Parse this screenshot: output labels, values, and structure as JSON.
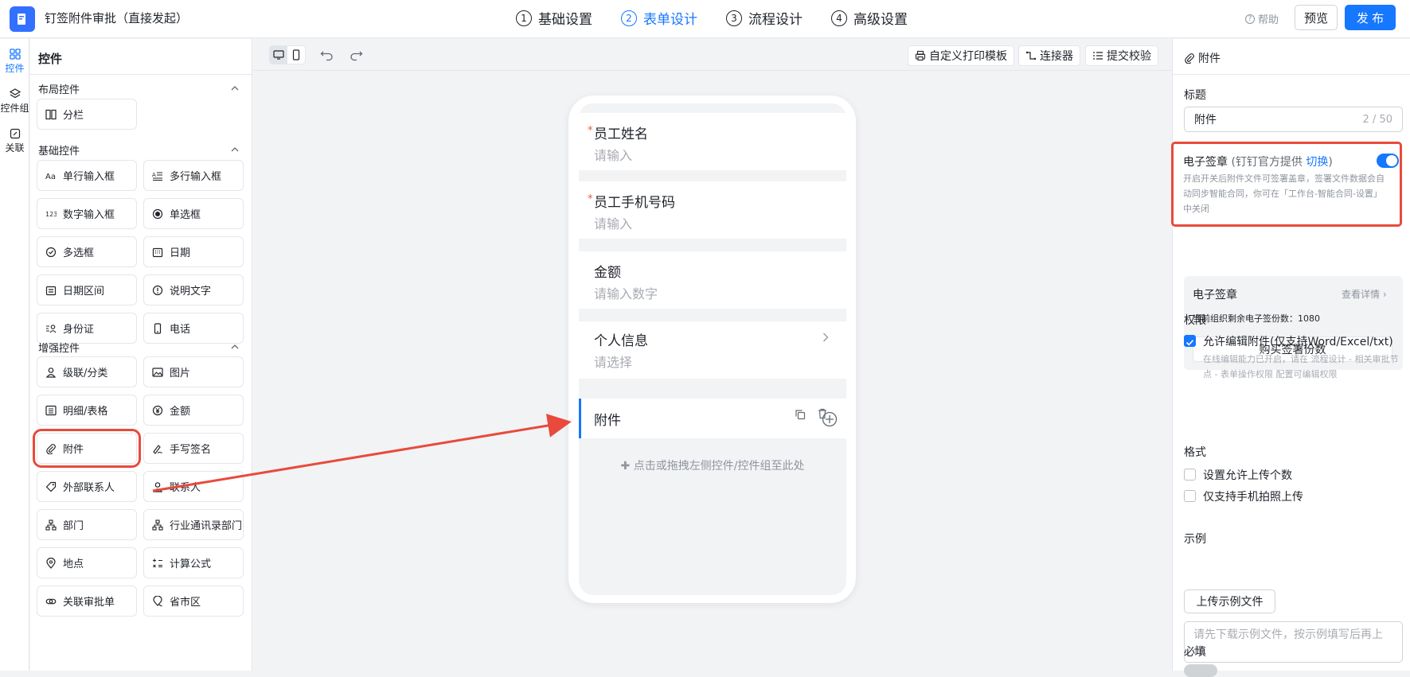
{
  "app": {
    "title": "钉签附件审批（直接发起）"
  },
  "steps": [
    {
      "num": "1",
      "label": "基础设置"
    },
    {
      "num": "2",
      "label": "表单设计"
    },
    {
      "num": "3",
      "label": "流程设计"
    },
    {
      "num": "4",
      "label": "高级设置"
    }
  ],
  "header": {
    "help": "帮助",
    "preview": "预览",
    "publish": "发 布"
  },
  "rail": {
    "items": [
      "控件",
      "控件组",
      "关联"
    ]
  },
  "controls": {
    "title": "控件",
    "sections": {
      "layout": "布局控件",
      "basic": "基础控件",
      "enhanced": "增强控件"
    },
    "layout_items": [
      "分栏"
    ],
    "basic_items": [
      "单行输入框",
      "多行输入框",
      "数字输入框",
      "单选框",
      "多选框",
      "日期",
      "日期区间",
      "说明文字",
      "身份证",
      "电话"
    ],
    "enhanced_items": [
      "级联/分类",
      "图片",
      "明细/表格",
      "金额",
      "附件",
      "手写签名",
      "外部联系人",
      "联系人",
      "部门",
      "行业通讯录部门",
      "地点",
      "计算公式",
      "关联审批单",
      "省市区"
    ]
  },
  "toolbar": {
    "print": "自定义打印模板",
    "connector": "连接器",
    "validate": "提交校验"
  },
  "form": {
    "fields": [
      {
        "label": "员工姓名",
        "placeholder": "请输入",
        "required": "*"
      },
      {
        "label": "员工手机号码",
        "placeholder": "请输入",
        "required": "*"
      },
      {
        "label": "金额",
        "placeholder": "请输入数字"
      },
      {
        "label": "个人信息",
        "placeholder": "请选择"
      },
      {
        "label": "附件"
      }
    ],
    "add_tip": "✚ 点击或拖拽左侧控件/控件组至此处"
  },
  "props": {
    "head": "附件",
    "title_label": "标题",
    "title_value": "附件",
    "title_count": "2 / 50",
    "esign": {
      "title": "电子签章",
      "sub_prefix": " (钉钉官方提供 ",
      "link": "切换",
      "sub_suffix": ")",
      "desc": "开启开关后附件文件可签署盖章，签署文件数据会自动同步智能合同，你可在「工作台-智能合同-设置」中关闭"
    },
    "quota": {
      "title": "电子签章",
      "more": "查看详情",
      "remaining": "当前组织剩余电子签份数：1080",
      "buy": "购买签署份数"
    },
    "perm_label": "权限",
    "perm_check": "允许编辑附件(仅支持Word/Excel/txt)",
    "perm_hint": "在线编辑能力已开启，请在 流程设计 - 相关审批节点 - 表单操作权限 配置可编辑权限",
    "format_label": "格式",
    "format_opts": [
      "设置允许上传个数",
      "仅支持手机拍照上传"
    ],
    "sample_label": "示例",
    "sample_btn": "上传示例文件",
    "sample_placeholder": "请先下载示例文件，按示例填写后再上传",
    "required_label": "必填"
  }
}
